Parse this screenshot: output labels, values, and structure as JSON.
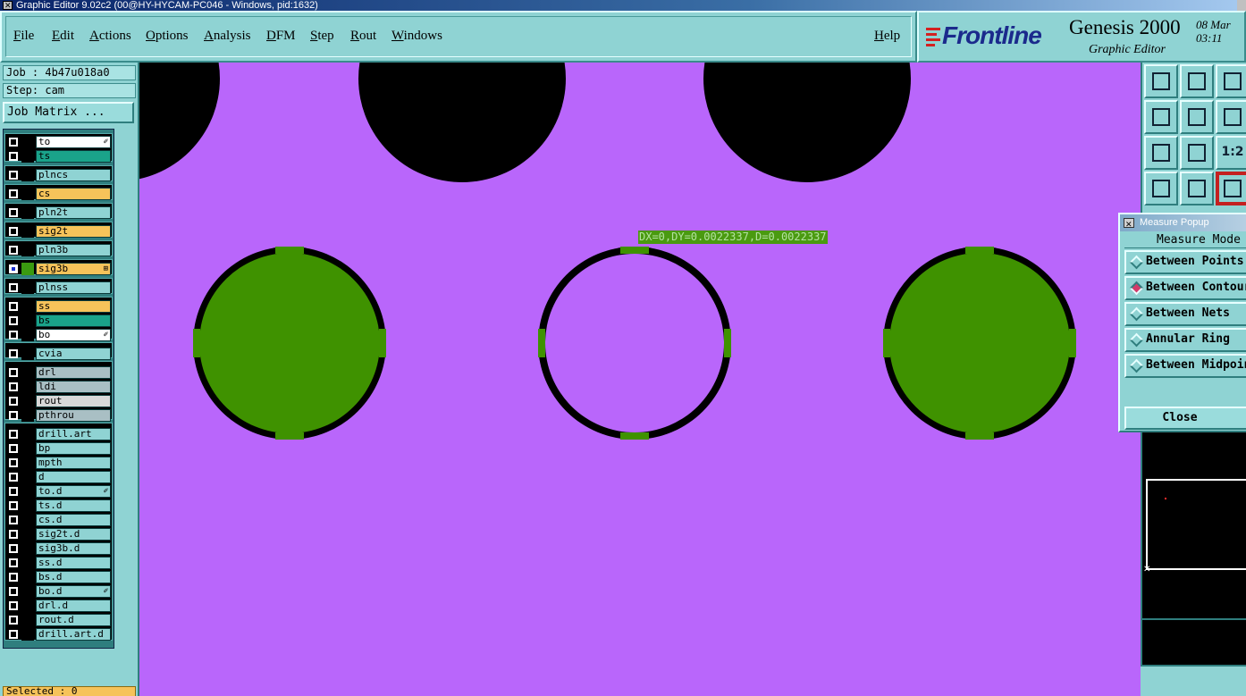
{
  "window": {
    "title": "Graphic Editor 9.02c2 (00@HY-HYCAM-PC046 - Windows, pid:1632)"
  },
  "menu": {
    "items": [
      "File",
      "Edit",
      "Actions",
      "Options",
      "Analysis",
      "DFM",
      "Step",
      "Rout",
      "Windows"
    ],
    "help": "Help"
  },
  "brand": {
    "logo_text": "Frontline",
    "product": "Genesis 2000",
    "subtitle": "Graphic Editor",
    "date": "08 Mar",
    "time": "03:11"
  },
  "job": {
    "job_label": "Job : 4b47u018a0",
    "step_label": "Step: cam",
    "job_matrix_button": "Job Matrix ..."
  },
  "layers": [
    {
      "name": "to",
      "color": "#ffffff",
      "flag": "✐"
    },
    {
      "name": "ts",
      "color": "#1aa38a"
    },
    {
      "name": "plncs",
      "color": "#8fd3d3"
    },
    {
      "name": "cs",
      "color": "#f6c35a"
    },
    {
      "name": "pln2t",
      "color": "#8fd3d3"
    },
    {
      "name": "sig2t",
      "color": "#f6c35a"
    },
    {
      "name": "pln3b",
      "color": "#8fd3d3"
    },
    {
      "name": "sig3b",
      "color": "#f6c35a",
      "selected": true,
      "swatch": "#3a9a10",
      "flag": "⊞"
    },
    {
      "name": "plnss",
      "color": "#8fd3d3"
    },
    {
      "name": "ss",
      "color": "#f6c35a"
    },
    {
      "name": "bs",
      "color": "#1aa38a"
    },
    {
      "name": "bo",
      "color": "#ffffff",
      "flag": "✐"
    },
    {
      "name": "cvia",
      "color": "#8fd3d3"
    },
    {
      "name": "drl",
      "color": "#a9bfc4"
    },
    {
      "name": "ldi",
      "color": "#a9bfc4"
    },
    {
      "name": "rout",
      "color": "#d8d8d8"
    },
    {
      "name": "pthrou",
      "color": "#a9bfc4"
    },
    {
      "name": "drill.art",
      "color": "#8fd3d3"
    },
    {
      "name": "bp",
      "color": "#8fd3d3"
    },
    {
      "name": "mpth",
      "color": "#8fd3d3"
    },
    {
      "name": "d",
      "color": "#8fd3d3"
    },
    {
      "name": "to.d",
      "color": "#8fd3d3",
      "flag": "✐"
    },
    {
      "name": "ts.d",
      "color": "#8fd3d3"
    },
    {
      "name": "cs.d",
      "color": "#8fd3d3"
    },
    {
      "name": "sig2t.d",
      "color": "#8fd3d3"
    },
    {
      "name": "sig3b.d",
      "color": "#8fd3d3"
    },
    {
      "name": "ss.d",
      "color": "#8fd3d3"
    },
    {
      "name": "bs.d",
      "color": "#8fd3d3"
    },
    {
      "name": "bo.d",
      "color": "#8fd3d3",
      "flag": "✐"
    },
    {
      "name": "drl.d",
      "color": "#8fd3d3"
    },
    {
      "name": "rout.d",
      "color": "#8fd3d3"
    },
    {
      "name": "drill.art.d",
      "color": "#8fd3d3"
    }
  ],
  "status": {
    "selected": "Selected : 0"
  },
  "canvas": {
    "background": "#b966fb",
    "pad_color": "#3f9200",
    "measure_readout": "DX=0,DY=0.0022337,D=0.0022337"
  },
  "toolbar": {
    "buttons": [
      {
        "icon": "zoom-up-icon"
      },
      {
        "icon": "zoom-down-icon"
      },
      {
        "icon": "home-icon"
      },
      {
        "icon": "pan-left-icon"
      },
      {
        "icon": "pan-right-icon"
      },
      {
        "icon": "undo-view-icon"
      },
      {
        "icon": "fit-screen-icon"
      },
      {
        "icon": "fit-profile-icon"
      },
      {
        "label": "1:2",
        "icon": "ratio-icon"
      },
      {
        "icon": "snap-tool-icon"
      },
      {
        "icon": "grid-icon"
      },
      {
        "icon": "measure-tool-icon",
        "active": true
      }
    ]
  },
  "measure_popup": {
    "title": "Measure Popup",
    "mode_header": "Measure Mode",
    "options": [
      {
        "label": "Between Points",
        "selected": false
      },
      {
        "label": "Between Contours",
        "selected": true
      },
      {
        "label": "Between Nets",
        "selected": false
      },
      {
        "label": "Annular Ring",
        "selected": false
      },
      {
        "label": "Between Midpoints",
        "selected": false
      }
    ],
    "close": "Close"
  }
}
